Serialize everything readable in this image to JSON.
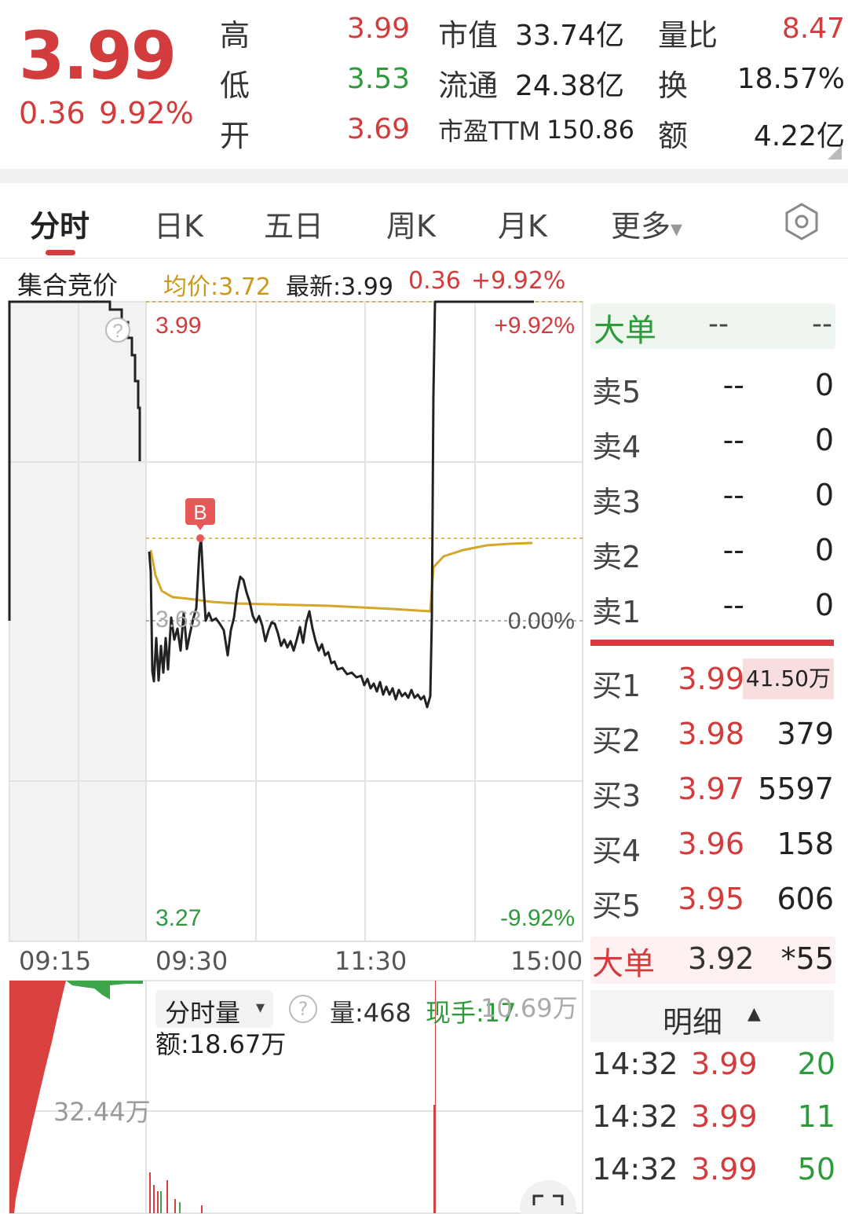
{
  "header": {
    "price": "3.99",
    "change": "0.36",
    "change_pct": "9.92%",
    "stats": [
      {
        "label": "高",
        "value": "3.99"
      },
      {
        "label": "低",
        "value": "3.53"
      },
      {
        "label": "开",
        "value": "3.69"
      }
    ],
    "market": [
      {
        "label": "市值",
        "value": "33.74亿"
      },
      {
        "label": "流通",
        "value": "24.38亿"
      },
      {
        "label": "市盈TTM",
        "value": "150.86"
      }
    ],
    "right": [
      {
        "label": "量比",
        "value": "8.47"
      },
      {
        "label": "换",
        "value": "18.57%"
      },
      {
        "label": "额",
        "value": "4.22亿"
      }
    ]
  },
  "tabs": [
    "分时",
    "日K",
    "五日",
    "周K",
    "月K",
    "更多"
  ],
  "tab_more_caret": "▾",
  "infobar": {
    "auction": "集合竞价",
    "avg": "均价:3.72",
    "latest": "最新:3.99",
    "change": "0.36",
    "pct": "+9.92%"
  },
  "chart_labels": {
    "high": "3.99",
    "high_pct": "+9.92%",
    "mid": "3.63",
    "mid_pct": "0.00%",
    "low": "3.27",
    "low_pct": "-9.92%",
    "marker": "B",
    "help": "?"
  },
  "time_axis": [
    "09:15",
    "09:30",
    "11:30",
    "15:00"
  ],
  "volume": {
    "selector": "分时量",
    "selector_caret": "▾",
    "help": "?",
    "qty": "量:468",
    "hand": "现手:17",
    "max": "10.69万",
    "amount": "额:18.67万",
    "auction_max": "32.44万"
  },
  "book": {
    "big_top_label": "大单",
    "big_top_a": "--",
    "big_top_b": "--",
    "sell": [
      {
        "label": "卖5",
        "price": "--",
        "qty": "0"
      },
      {
        "label": "卖4",
        "price": "--",
        "qty": "0"
      },
      {
        "label": "卖3",
        "price": "--",
        "qty": "0"
      },
      {
        "label": "卖2",
        "price": "--",
        "qty": "0"
      },
      {
        "label": "卖1",
        "price": "--",
        "qty": "0"
      }
    ],
    "buy": [
      {
        "label": "买1",
        "price": "3.99",
        "qty": "41.50万"
      },
      {
        "label": "买2",
        "price": "3.98",
        "qty": "379"
      },
      {
        "label": "买3",
        "price": "3.97",
        "qty": "5597"
      },
      {
        "label": "买4",
        "price": "3.96",
        "qty": "158"
      },
      {
        "label": "买5",
        "price": "3.95",
        "qty": "606"
      }
    ],
    "big_bottom_label": "大单",
    "big_bottom_price": "3.92",
    "big_bottom_qty": "*55",
    "detail_label": "明细",
    "detail_caret": "▲",
    "trades": [
      {
        "time": "14:32",
        "price": "3.99",
        "vol": "20"
      },
      {
        "time": "14:32",
        "price": "3.99",
        "vol": "11"
      },
      {
        "time": "14:32",
        "price": "3.99",
        "vol": "50"
      }
    ]
  },
  "colors": {
    "up": "#d23c3c",
    "down": "#2e9a3c",
    "avg_line": "#d4a62a",
    "price_line": "#222222"
  }
}
